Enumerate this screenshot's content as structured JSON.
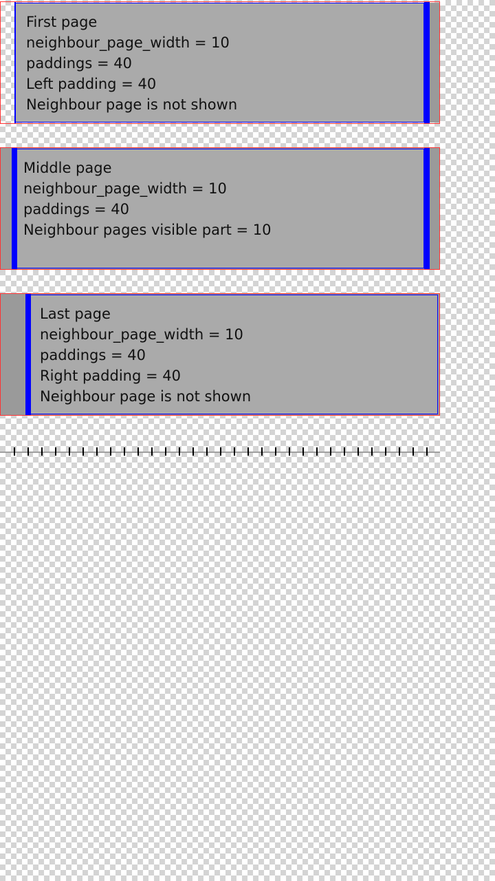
{
  "pages": [
    {
      "lines": [
        "First page",
        "neighbour_page_width = 10",
        "paddings = 40",
        "Left padding = 40",
        "Neighbour page is not shown"
      ]
    },
    {
      "lines": [
        "Middle page",
        "neighbour_page_width = 10",
        "paddings = 40",
        "Neighbour pages visible part = 10"
      ]
    },
    {
      "lines": [
        "Last page",
        "neighbour_page_width = 10",
        "paddings = 40",
        "Right padding = 40",
        "Neighbour page is not shown"
      ]
    }
  ],
  "colors": {
    "page_fill": "#aaaaaa",
    "page_border": "#0000ff",
    "pager_border": "#ff3333",
    "neighbour_bar": "#0000ff"
  },
  "ruler": {
    "tick_count": 31
  }
}
